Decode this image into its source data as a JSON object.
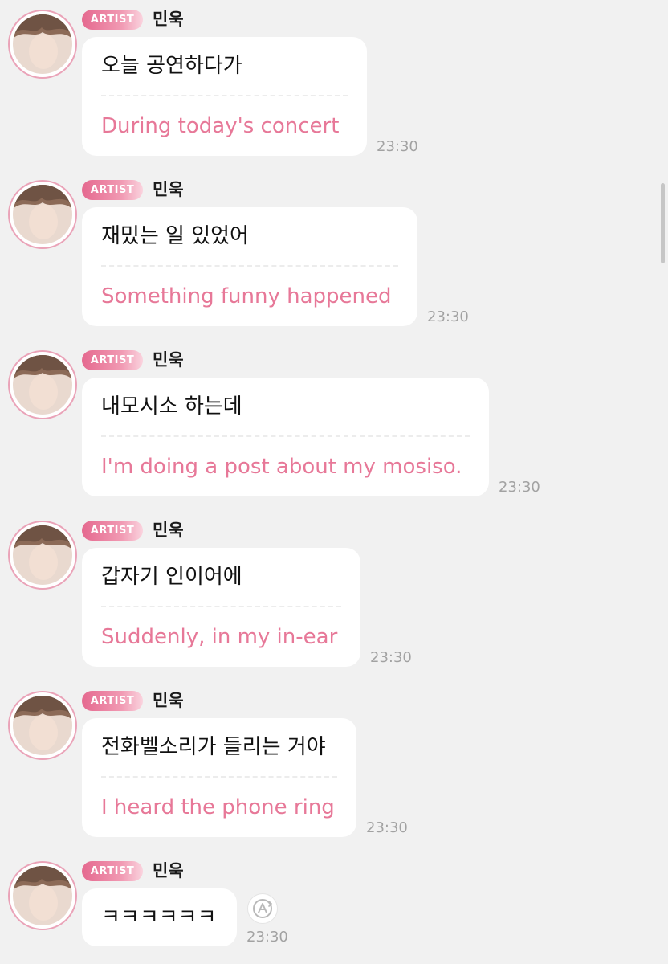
{
  "messages": [
    {
      "badge": "ARTIST",
      "name": "민욱",
      "korean": "오늘 공연하다가",
      "english": "During today's concert",
      "time": "23:30"
    },
    {
      "badge": "ARTIST",
      "name": "민욱",
      "korean": "재밌는 일 있었어",
      "english": "Something funny happened",
      "time": "23:30"
    },
    {
      "badge": "ARTIST",
      "name": "민욱",
      "korean": "내모시소 하는데",
      "english": "I'm doing a post about my mosiso.",
      "time": "23:30"
    },
    {
      "badge": "ARTIST",
      "name": "민욱",
      "korean": "갑자기 인이어에",
      "english": "Suddenly, in my in-ear",
      "time": "23:30"
    },
    {
      "badge": "ARTIST",
      "name": "민욱",
      "korean": "전화벨소리가 들리는 거야",
      "english": "I heard the phone ring",
      "time": "23:30"
    },
    {
      "badge": "ARTIST",
      "name": "민욱",
      "korean": "ㅋㅋㅋㅋㅋㅋ",
      "time": "23:30"
    }
  ],
  "icons": {
    "translate": "translate-icon",
    "avatar": "avatar"
  },
  "colors": {
    "accent_pink": "#e77898",
    "badge_start": "#e5698f",
    "background": "#f1f1f1"
  }
}
